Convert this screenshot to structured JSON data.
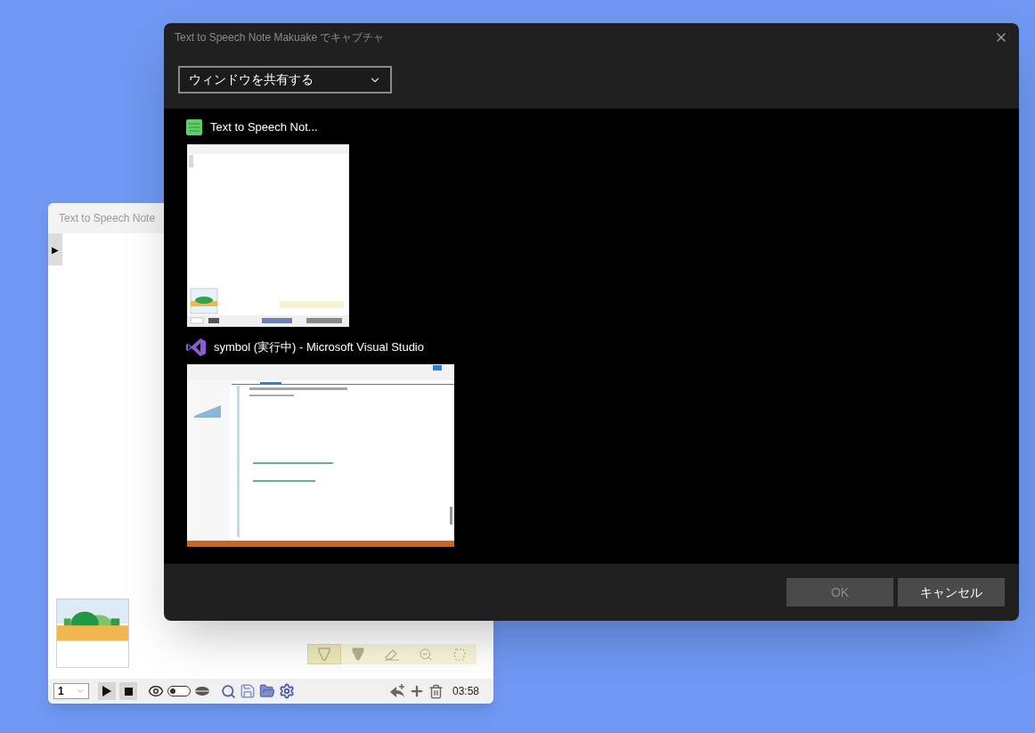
{
  "back_window": {
    "title": "Text to Speech Note",
    "sidebar_toggle": "▶",
    "page_select": {
      "value": "1"
    },
    "voice_toggle": {
      "on": false
    },
    "time": "03:58",
    "tools": [
      {
        "kind": "pen",
        "selected": true
      },
      {
        "kind": "marker",
        "selected": false
      },
      {
        "kind": "eraser",
        "selected": false
      },
      {
        "kind": "zoom",
        "selected": false
      },
      {
        "kind": "lasso",
        "selected": false
      }
    ]
  },
  "dialog": {
    "title": "Text to Speech Note Makuake でキャプチャ",
    "source_select": {
      "value": "ウィンドウを共有する"
    },
    "windows": [
      {
        "kind": "note",
        "title": "Text to Speech Not..."
      },
      {
        "kind": "studio",
        "title": "symbol (実行中) - Microsoft Visual Studio"
      }
    ],
    "buttons": [
      {
        "label": "OK",
        "disabled": true
      },
      {
        "label": "キャンセル",
        "disabled": false
      }
    ]
  }
}
